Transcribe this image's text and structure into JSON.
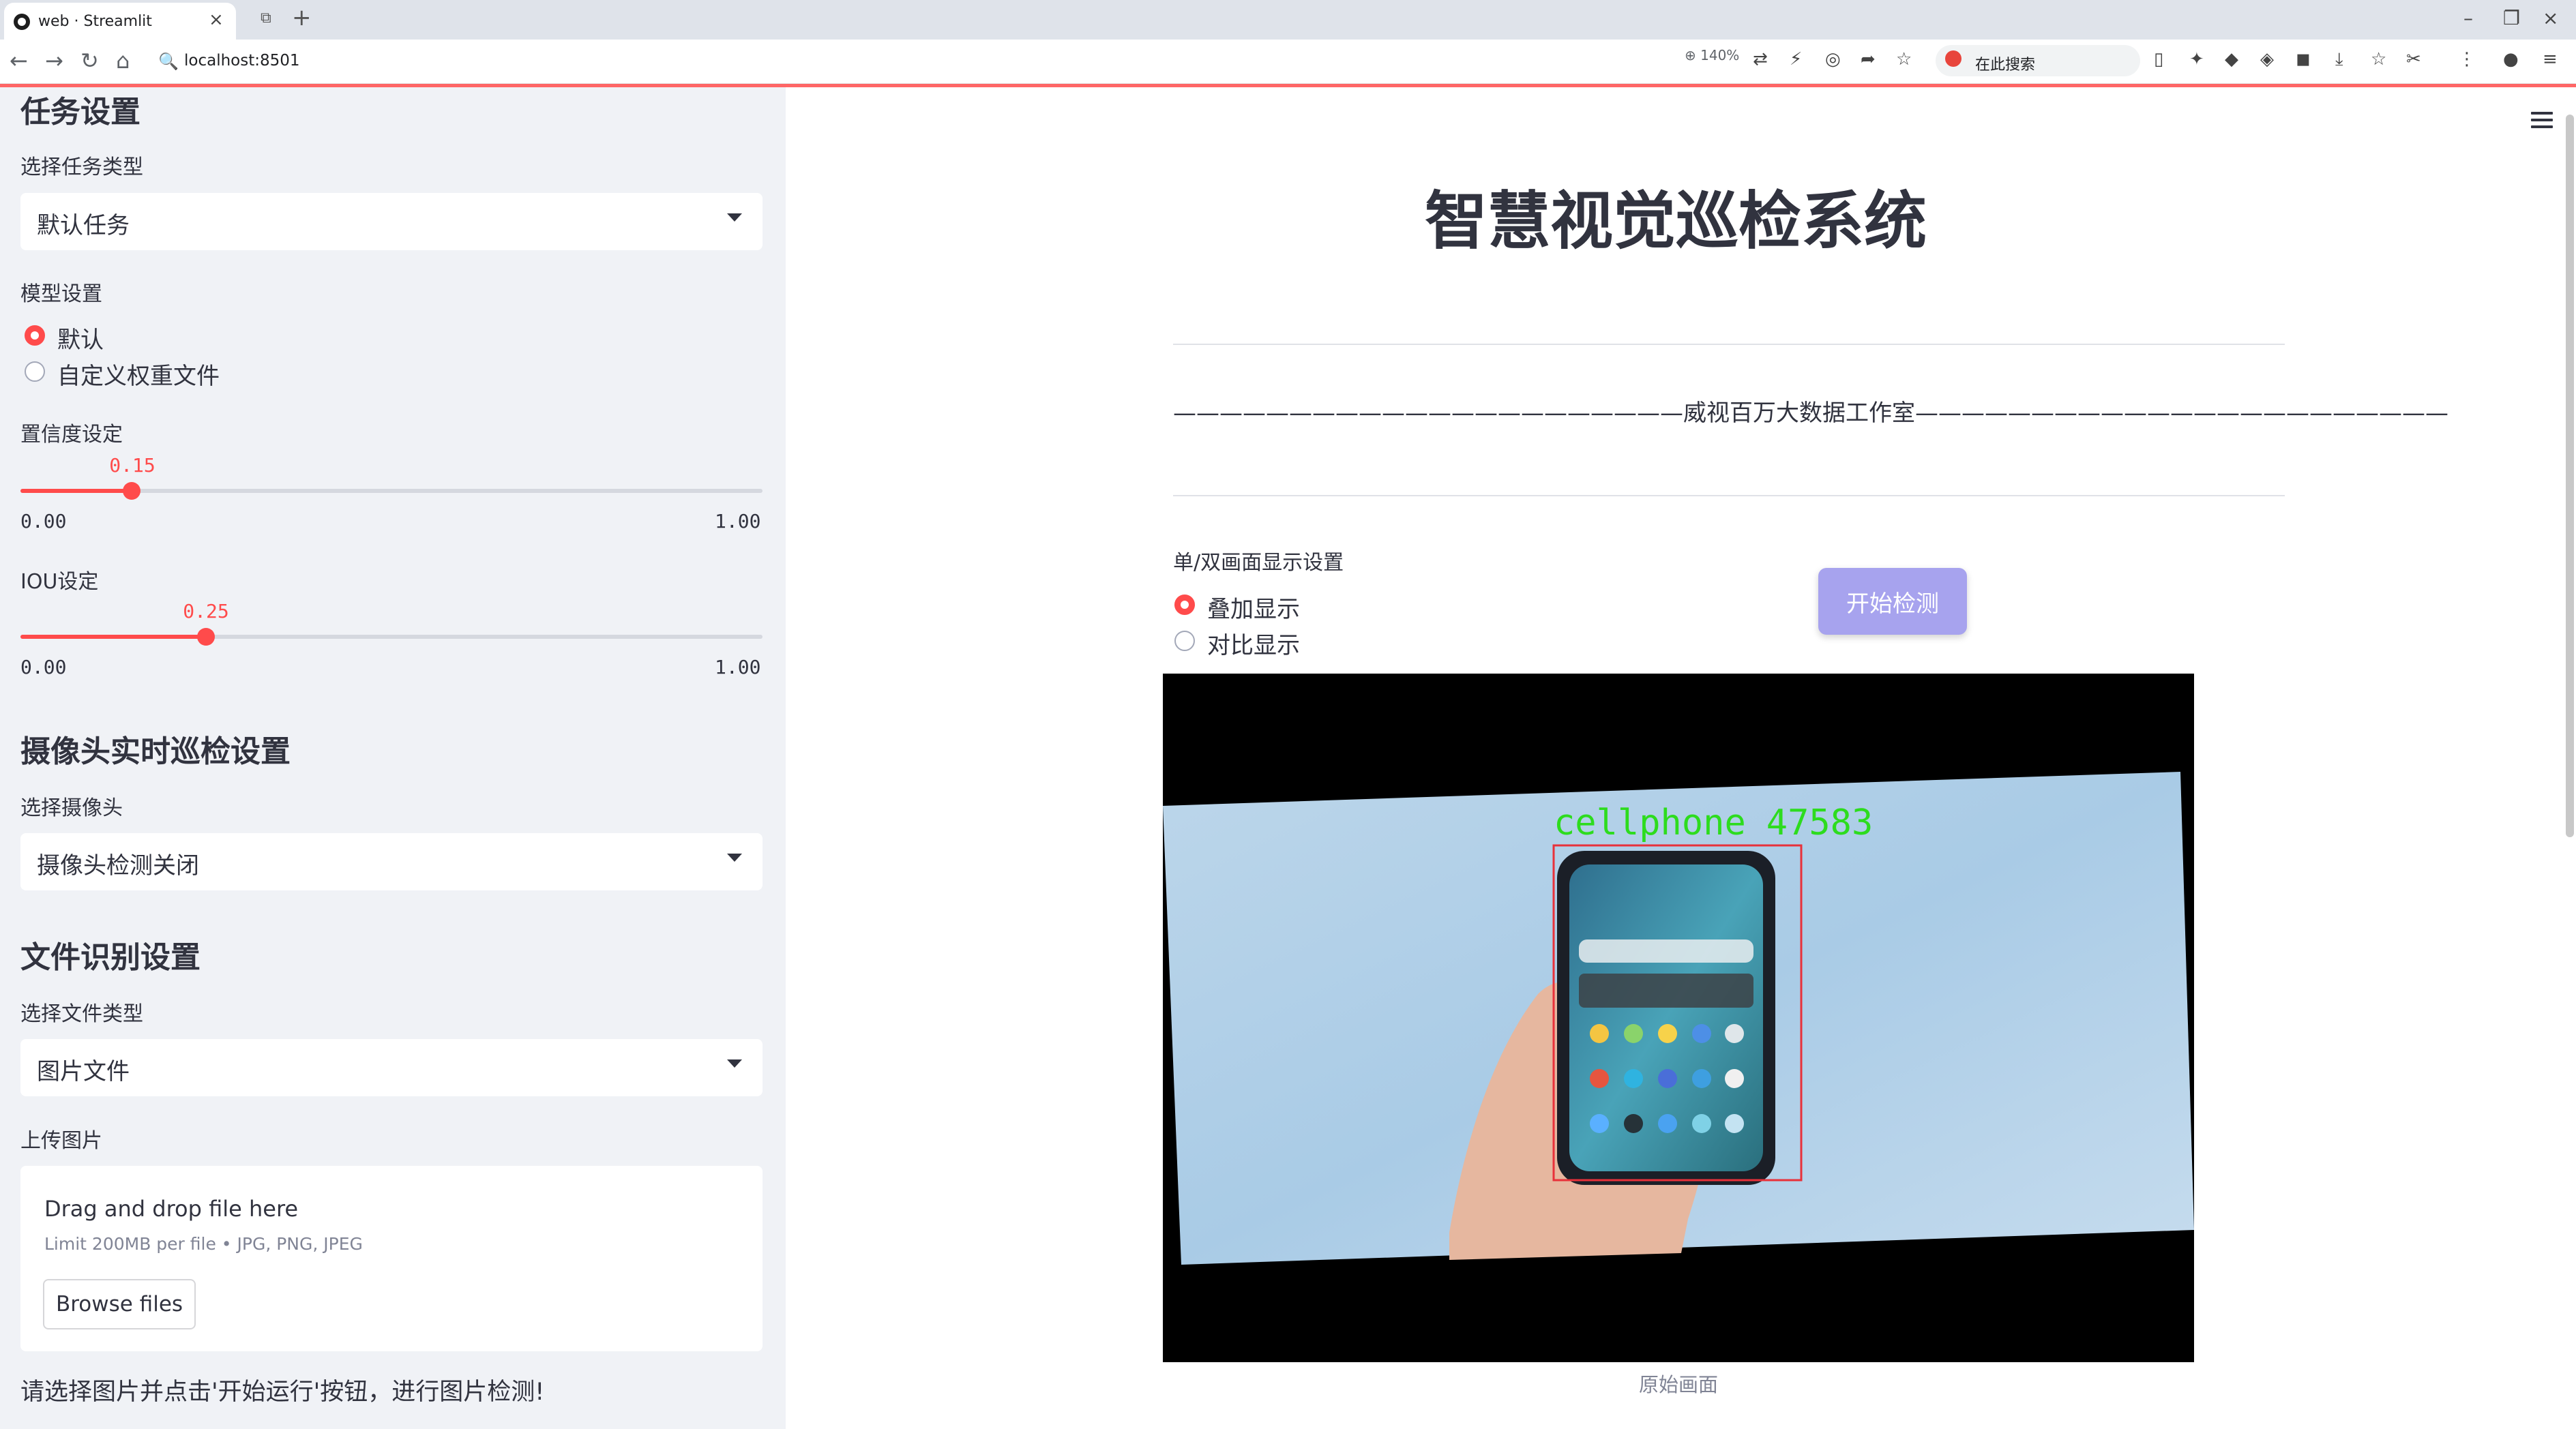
{
  "browser": {
    "tab_title": "web · Streamlit",
    "url": "localhost:8501",
    "zoom": "140%",
    "search_label": "在此搜索",
    "accent_color": "#ff4b4b"
  },
  "sidebar": {
    "task_section": {
      "heading": "任务设置",
      "task_type_label": "选择任务类型",
      "task_type_value": "默认任务"
    },
    "model_section": {
      "label": "模型设置",
      "options": [
        "默认",
        "自定义权重文件"
      ],
      "selected": "默认"
    },
    "confidence": {
      "label": "置信度设定",
      "value": "0.15",
      "fraction": 0.15,
      "min": "0.00",
      "max": "1.00"
    },
    "iou": {
      "label": "IOU设定",
      "value": "0.25",
      "fraction": 0.25,
      "min": "0.00",
      "max": "1.00"
    },
    "camera_section": {
      "heading": "摄像头实时巡检设置",
      "label": "选择摄像头",
      "value": "摄像头检测关闭"
    },
    "file_section": {
      "heading": "文件识别设置",
      "file_type_label": "选择文件类型",
      "file_type_value": "图片文件",
      "upload_label": "上传图片",
      "drop_title": "Drag and drop file here",
      "drop_limit": "Limit 200MB per file • JPG, PNG, JPEG",
      "browse_label": "Browse files"
    },
    "note": "请选择图片并点击'开始运行'按钮，进行图片检测!"
  },
  "main": {
    "title": "智慧视觉巡检系统",
    "studio_line": "——————————————————————威视百万大数据工作室———————————————————————",
    "display_mode_label": "单/双画面显示设置",
    "display_options": [
      "叠加显示",
      "对比显示"
    ],
    "display_selected": "叠加显示",
    "start_button": "开始检测",
    "detection": {
      "label": "cellphone",
      "score": "47583",
      "box_color": "#e8313a",
      "label_color": "#2ddc1e"
    },
    "caption": "原始画面"
  }
}
